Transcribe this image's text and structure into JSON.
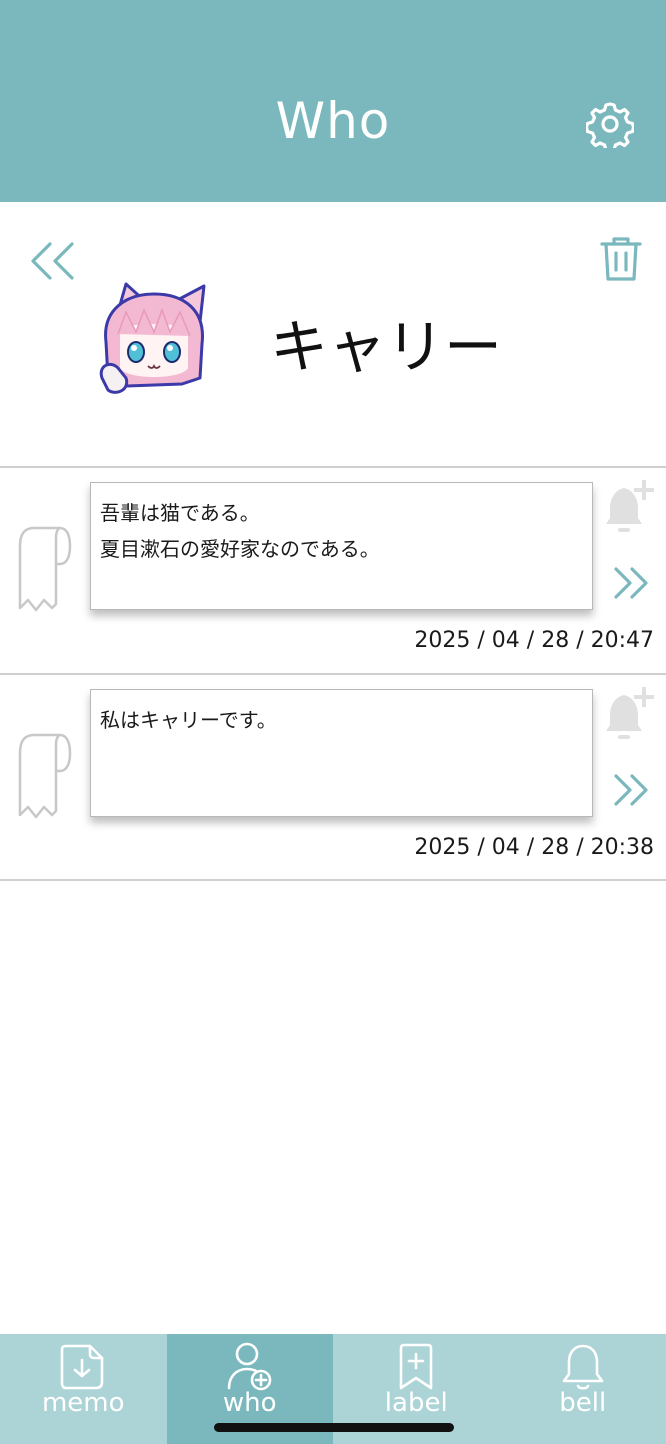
{
  "header": {
    "title": "Who"
  },
  "profile": {
    "name": "キャリー"
  },
  "memos": [
    {
      "lines": [
        "吾輩は猫である。",
        "夏目漱石の愛好家なのである。"
      ],
      "date": "2025 / 04 / 28 / 20:47"
    },
    {
      "lines": [
        "私はキャリーです。"
      ],
      "date": "2025 / 04 / 28 / 20:38"
    }
  ],
  "nav": {
    "items": [
      {
        "label": "memo",
        "icon": "memo-download-icon"
      },
      {
        "label": "who",
        "icon": "user-add-icon",
        "active": true
      },
      {
        "label": "label",
        "icon": "bookmark-add-icon"
      },
      {
        "label": "bell",
        "icon": "bell-icon"
      }
    ]
  },
  "colors": {
    "accent": "#7bb8bd",
    "nav_inactive": "#acd3d5",
    "divider": "#cfcfcf",
    "icon_gray": "#dcdcdc"
  }
}
